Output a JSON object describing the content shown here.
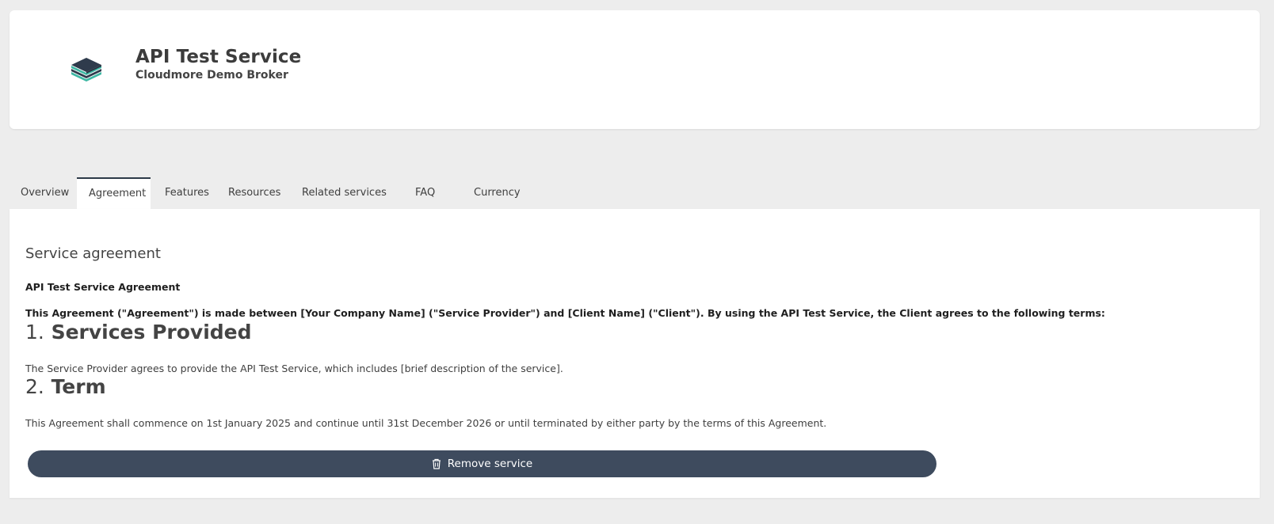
{
  "header": {
    "logo_icon": "layers-stack-icon",
    "title": "API Test Service",
    "subtitle": "Cloudmore Demo Broker"
  },
  "tabs": [
    {
      "label": "Overview",
      "active": false
    },
    {
      "label": "Agreement",
      "active": true
    },
    {
      "label": "Features",
      "active": false
    },
    {
      "label": "Resources",
      "active": false
    },
    {
      "label": "Related services",
      "active": false
    },
    {
      "label": "FAQ",
      "active": false
    },
    {
      "label": "Currency",
      "active": false
    }
  ],
  "agreement": {
    "section_heading": "Service agreement",
    "title": "API Test Service Agreement",
    "intro": "This Agreement (\"Agreement\") is made between [Your Company Name] (\"Service Provider\") and [Client Name] (\"Client\"). By using the API Test Service, the Client agrees to the following terms:",
    "clauses": [
      {
        "number": "1.",
        "title": "Services Provided",
        "text": "The Service Provider agrees to provide the API Test Service, which includes [brief description of the service]."
      },
      {
        "number": "2.",
        "title": "Term",
        "text": "This Agreement shall commence on 1st January 2025 and continue until 31st December 2026 or until terminated by either party by the terms of this Agreement."
      }
    ]
  },
  "actions": {
    "remove_label": "Remove service",
    "remove_icon": "trash-icon"
  },
  "colors": {
    "background": "#ededed",
    "card": "#ffffff",
    "button": "#3e4b5e",
    "active_tab_border": "#2d3a48",
    "logo_dark": "#2f3b4c",
    "logo_accent": "#3fb8a4"
  }
}
